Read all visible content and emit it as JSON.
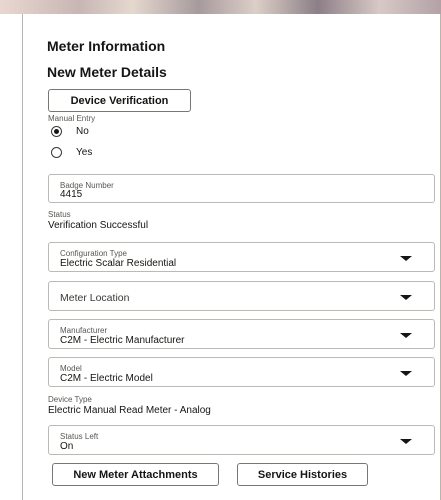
{
  "header": {
    "title": "Meter Information",
    "subtitle": "New Meter Details"
  },
  "buttons": {
    "device_verification": "Device Verification",
    "new_meter_attachments": "New Meter Attachments",
    "service_histories": "Service Histories"
  },
  "manual_entry": {
    "label": "Manual Entry",
    "options": [
      {
        "label": "No",
        "selected": true
      },
      {
        "label": "Yes",
        "selected": false
      }
    ]
  },
  "badge_number": {
    "label": "Badge Number",
    "value": "4415"
  },
  "status": {
    "label": "Status",
    "value": "Verification Successful"
  },
  "configuration_type": {
    "label": "Configuration Type",
    "value": "Electric Scalar Residential"
  },
  "meter_location": {
    "placeholder": "Meter Location"
  },
  "manufacturer": {
    "label": "Manufacturer",
    "value": "C2M - Electric Manufacturer"
  },
  "model": {
    "label": "Model",
    "value": "C2M - Electric Model"
  },
  "device_type": {
    "label": "Device Type",
    "value": "Electric Manual Read Meter - Analog"
  },
  "status_left": {
    "label": "Status Left",
    "value": "On"
  },
  "icons": {
    "dropdown": "chevron-down-icon"
  }
}
